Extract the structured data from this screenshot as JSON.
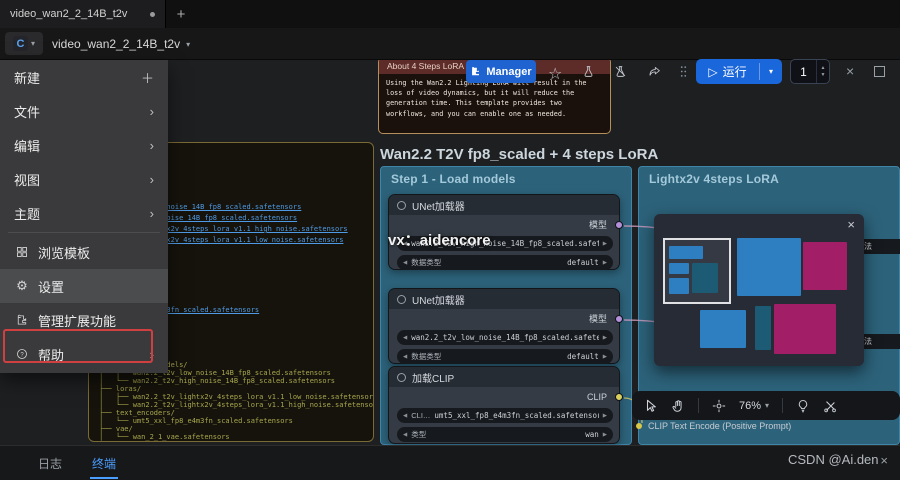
{
  "tab_bar": {
    "tab_title": "video_wan2_2_14B_t2v",
    "new_tab_label": "+"
  },
  "toolbar": {
    "logo_letter": "C",
    "workflow_name": "video_wan2_2_14B_t2v",
    "manager_label": "Manager",
    "run_label": "运行",
    "queue_count": "1"
  },
  "menu": {
    "items": [
      {
        "label": "新建"
      },
      {
        "label": "文件"
      },
      {
        "label": "编辑"
      },
      {
        "label": "视图"
      },
      {
        "label": "主题"
      },
      {
        "label": "浏览模板"
      },
      {
        "label": "设置"
      },
      {
        "label": "管理扩展功能"
      },
      {
        "label": "帮助"
      }
    ]
  },
  "note_node": {
    "title": "About 4 Steps LoRA",
    "body": "Using the Wan2.2 Lighting LoRA will result in the loss of video dynamics, but it will reduce the generation time. This template provides two workflows, and you can enable one as needed."
  },
  "models_note": {
    "links": [
      "wan2.2_t2v_high_noise_14B_fp8_scaled.safetensors",
      "wan2.2_t2v_low_noise_14B_fp8_scaled.safetensors",
      "wan2.2_t2v_lightx2v_4steps_lora_v1.1_high_noise.safetensors",
      "wan2.2_t2v_lightx2v_4steps_lora_v1.1_low_noise.safetensors",
      "umt5_xxl_fp8_e4m3fn_scaled.safetensors"
    ],
    "tree": [
      "├── diffusion_models/",
      "│   ├── wan2.2_t2v_low_noise_14B_fp8_scaled.safetensors",
      "│   └── wan2.2_t2v_high_noise_14B_fp8_scaled.safetensors",
      "├── loras/",
      "│   ├── wan2.2_t2v_lightx2v_4steps_lora_v1.1_low_noise.safetensors",
      "│   └── wan2.2_t2v_lightx2v_4steps_lora_v1.1_high_noise.safetensors",
      "├── text_encoders/",
      "│   └── umt5_xxl_fp8_e4m3fn_scaled.safetensors",
      "├── vae/",
      "│   └── wan_2_1_vae.safetensors"
    ]
  },
  "workflow": {
    "main_group_title": "Wan2.2 T2V fp8_scaled +  4 steps LoRA",
    "step1_group_title": "Step 1 - Load models",
    "lora_group_title": "Lightx2v 4steps LoRA",
    "nodes": [
      {
        "title": "UNet加载器",
        "output_label": "模型",
        "widget1_value": "wan2.2_t2v_high_noise_14B_fp8_scaled.safet",
        "widget2_label": "数据类型",
        "widget2_value": "default"
      },
      {
        "title": "UNet加载器",
        "output_label": "模型",
        "widget1_value": "wan2.2_t2v_low_noise_14B_fp8_scaled.safete",
        "widget2_label": "数据类型",
        "widget2_value": "default"
      },
      {
        "title": "加载CLIP",
        "output_label": "CLIP",
        "widget1_label": "CLI…",
        "widget1_value": "umt5_xxl_fp8_e4m3fn_scaled.safetensors",
        "widget2_label": "类型",
        "widget2_value": "wan"
      }
    ],
    "right_fragment_label_1": "算法",
    "right_fragment_label_2": "算法",
    "bottom_node_label": "CLIP Text Encode (Positive Prompt)"
  },
  "canvas_toolbar": {
    "zoom_level": "76%"
  },
  "bottom_panel": {
    "tabs": [
      {
        "label": "日志"
      },
      {
        "label": "终端"
      }
    ]
  },
  "watermarks": {
    "center": "vx：aidencore",
    "corner": "CSDN @Ai.den"
  }
}
